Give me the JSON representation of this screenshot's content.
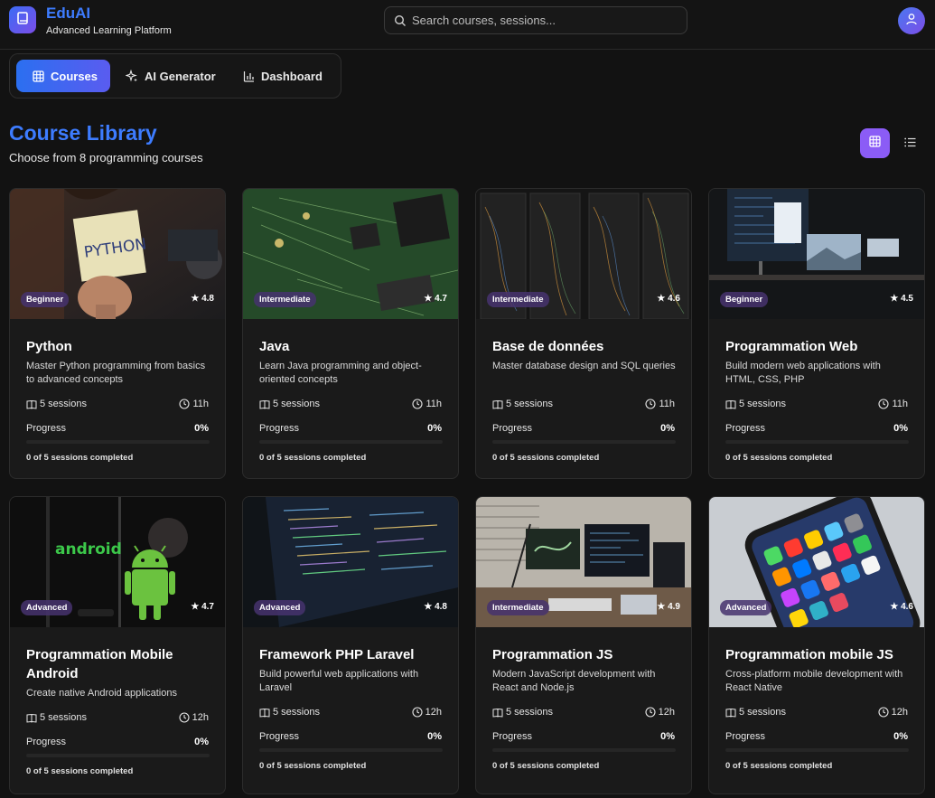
{
  "header": {
    "brand_name": "EduAI",
    "brand_sub": "Advanced Learning Platform",
    "logo_icon": "book-icon",
    "search_placeholder": "Search courses, sessions...",
    "user_icon": "user-icon"
  },
  "tabs": [
    {
      "label": "Courses",
      "icon": "grid-icon",
      "active": true
    },
    {
      "label": "AI Generator",
      "icon": "sparkles-icon",
      "active": false
    },
    {
      "label": "Dashboard",
      "icon": "bar-chart-icon",
      "active": false
    }
  ],
  "library": {
    "title": "Course Library",
    "subtitle": "Choose from 8 programming courses",
    "view_grid_icon": "grid-view-icon",
    "view_list_icon": "list-view-icon"
  },
  "colors": {
    "accent_blue": "#3d7cff",
    "accent_purple": "#8b5cf6",
    "background": "#121212",
    "card": "#1a1a1a"
  },
  "progress_label": "Progress",
  "courses": [
    {
      "title": "Python",
      "level": "Beginner",
      "rating": "★ 4.8",
      "desc": "Master Python programming from basics to advanced concepts",
      "sessions": "5 sessions",
      "hours": "11h",
      "progress": "0%",
      "completed": "0 of 5 sessions completed"
    },
    {
      "title": "Java",
      "level": "Intermediate",
      "rating": "★ 4.7",
      "desc": "Learn Java programming and object-oriented concepts",
      "sessions": "5 sessions",
      "hours": "11h",
      "progress": "0%",
      "completed": "0 of 5 sessions completed"
    },
    {
      "title": "Base de données",
      "level": "Intermediate",
      "rating": "★ 4.6",
      "desc": "Master database design and SQL queries",
      "sessions": "5 sessions",
      "hours": "11h",
      "progress": "0%",
      "completed": "0 of 5 sessions completed"
    },
    {
      "title": "Programmation Web",
      "level": "Beginner",
      "rating": "★ 4.5",
      "desc": "Build modern web applications with HTML, CSS, PHP",
      "sessions": "5 sessions",
      "hours": "11h",
      "progress": "0%",
      "completed": "0 of 5 sessions completed"
    },
    {
      "title": "Programmation Mobile Android",
      "level": "Advanced",
      "rating": "★ 4.7",
      "desc": "Create native Android applications",
      "sessions": "5 sessions",
      "hours": "12h",
      "progress": "0%",
      "completed": "0 of 5 sessions completed"
    },
    {
      "title": "Framework PHP Laravel",
      "level": "Advanced",
      "rating": "★ 4.8",
      "desc": "Build powerful web applications with Laravel",
      "sessions": "5 sessions",
      "hours": "12h",
      "progress": "0%",
      "completed": "0 of 5 sessions completed"
    },
    {
      "title": "Programmation JS",
      "level": "Intermediate",
      "rating": "★ 4.9",
      "desc": "Modern JavaScript development with React and Node.js",
      "sessions": "5 sessions",
      "hours": "12h",
      "progress": "0%",
      "completed": "0 of 5 sessions completed"
    },
    {
      "title": "Programmation mobile JS",
      "level": "Advanced",
      "rating": "★ 4.6",
      "desc": "Cross-platform mobile development with React Native",
      "sessions": "5 sessions",
      "hours": "12h",
      "progress": "0%",
      "completed": "0 of 5 sessions completed"
    }
  ],
  "images": {
    "python_note_text": "PYTHON",
    "android_text": "android"
  }
}
